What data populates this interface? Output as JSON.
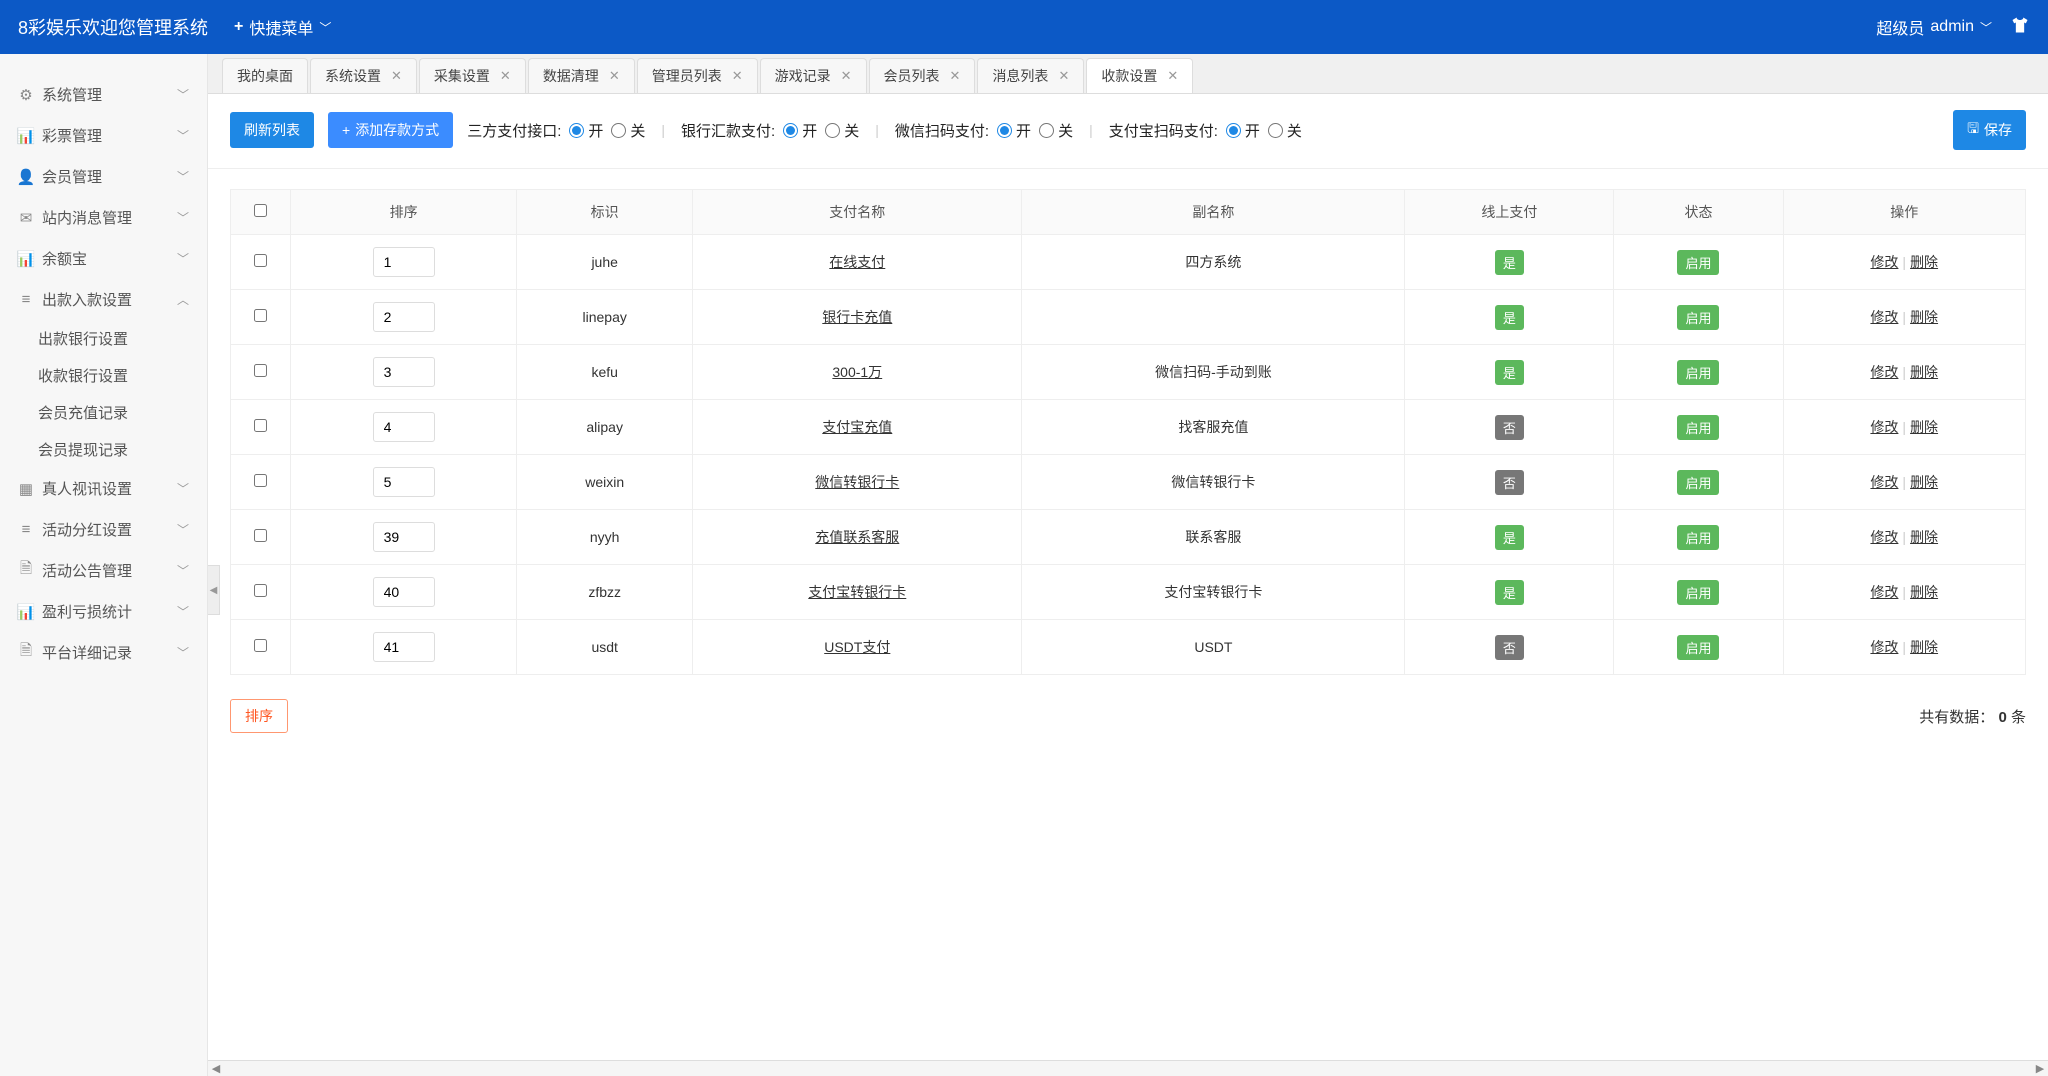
{
  "header": {
    "title": "8彩娱乐欢迎您管理系统",
    "quickmenu": "快捷菜单",
    "user_role": "超级员",
    "user_name": "admin"
  },
  "sidebar": {
    "items": [
      {
        "icon": "gear-icon",
        "label": "系统管理",
        "expandable": true,
        "open": false
      },
      {
        "icon": "chart-icon",
        "label": "彩票管理",
        "expandable": true,
        "open": false
      },
      {
        "icon": "user-icon",
        "label": "会员管理",
        "expandable": true,
        "open": false
      },
      {
        "icon": "mail-icon",
        "label": "站内消息管理",
        "expandable": true,
        "open": false
      },
      {
        "icon": "chart-icon",
        "label": "余额宝",
        "expandable": true,
        "open": false
      },
      {
        "icon": "list-icon",
        "label": "出款入款设置",
        "expandable": true,
        "open": true,
        "children": [
          "出款银行设置",
          "收款银行设置",
          "会员充值记录",
          "会员提现记录"
        ]
      },
      {
        "icon": "grid-icon",
        "label": "真人视讯设置",
        "expandable": true,
        "open": false
      },
      {
        "icon": "list-icon",
        "label": "活动分红设置",
        "expandable": true,
        "open": false
      },
      {
        "icon": "doc-icon",
        "label": "活动公告管理",
        "expandable": true,
        "open": false
      },
      {
        "icon": "chart-icon",
        "label": "盈利亏损统计",
        "expandable": true,
        "open": false
      },
      {
        "icon": "doc-icon",
        "label": "平台详细记录",
        "expandable": true,
        "open": false
      }
    ]
  },
  "tabs": [
    {
      "label": "我的桌面",
      "closable": false,
      "active": false
    },
    {
      "label": "系统设置",
      "closable": true,
      "active": false
    },
    {
      "label": "采集设置",
      "closable": true,
      "active": false
    },
    {
      "label": "数据清理",
      "closable": true,
      "active": false
    },
    {
      "label": "管理员列表",
      "closable": true,
      "active": false
    },
    {
      "label": "游戏记录",
      "closable": true,
      "active": false
    },
    {
      "label": "会员列表",
      "closable": true,
      "active": false
    },
    {
      "label": "消息列表",
      "closable": true,
      "active": false
    },
    {
      "label": "收款设置",
      "closable": true,
      "active": true
    }
  ],
  "toolbar": {
    "refresh_label": "刷新列表",
    "add_label": "添加存款方式",
    "save_label": "保存",
    "radio_on": "开",
    "radio_off": "关",
    "switches": [
      {
        "label": "三方支付接口:",
        "value": "on"
      },
      {
        "label": "银行汇款支付:",
        "value": "on"
      },
      {
        "label": "微信扫码支付:",
        "value": "on"
      },
      {
        "label": "支付宝扫码支付:",
        "value": "on"
      }
    ]
  },
  "table": {
    "headers": [
      "",
      "排序",
      "标识",
      "支付名称",
      "副名称",
      "线上支付",
      "状态",
      "操作"
    ],
    "op_edit": "修改",
    "op_delete": "删除",
    "online_yes": "是",
    "online_no": "否",
    "status_on": "启用",
    "rows": [
      {
        "sort": "1",
        "key": "juhe",
        "name": "在线支付",
        "sub": "四方系统",
        "online": true,
        "status": "on"
      },
      {
        "sort": "2",
        "key": "linepay",
        "name": "银行卡充值",
        "sub": "",
        "online": true,
        "status": "on"
      },
      {
        "sort": "3",
        "key": "kefu",
        "name": "300-1万",
        "sub": "微信扫码-手动到账",
        "online": true,
        "status": "on"
      },
      {
        "sort": "4",
        "key": "alipay",
        "name": "支付宝充值",
        "sub": "找客服充值",
        "online": false,
        "status": "on"
      },
      {
        "sort": "5",
        "key": "weixin",
        "name": "微信转银行卡",
        "sub": "微信转银行卡",
        "online": false,
        "status": "on"
      },
      {
        "sort": "39",
        "key": "nyyh",
        "name": "充值联系客服",
        "sub": "联系客服",
        "online": true,
        "status": "on"
      },
      {
        "sort": "40",
        "key": "zfbzz",
        "name": "支付宝转银行卡",
        "sub": "支付宝转银行卡",
        "online": true,
        "status": "on"
      },
      {
        "sort": "41",
        "key": "usdt",
        "name": "USDT支付",
        "sub": "USDT",
        "online": false,
        "status": "on"
      }
    ]
  },
  "footer": {
    "sort_btn": "排序",
    "total_prefix": "共有数据：",
    "total_count": "0",
    "total_suffix": " 条"
  }
}
